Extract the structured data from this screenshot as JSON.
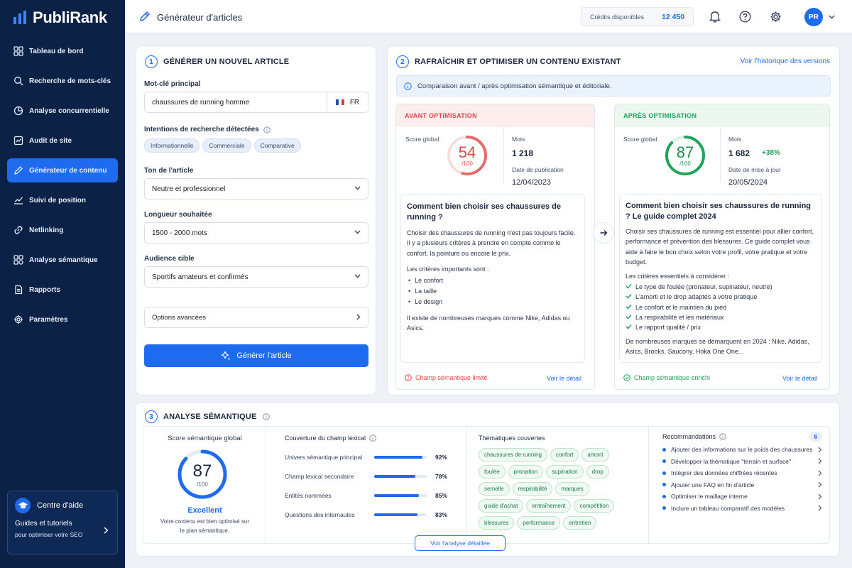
{
  "app": {
    "logo_text": "PubliRank"
  },
  "nav": [
    {
      "label": "Tableau de bord",
      "icon": "grid-icon"
    },
    {
      "label": "Recherche de mots-clés",
      "icon": "search-icon"
    },
    {
      "label": "Analyse concurrentielle",
      "icon": "competition-icon"
    },
    {
      "label": "Audit de site",
      "icon": "audit-icon"
    },
    {
      "label": "Générateur de contenu",
      "icon": "pen-icon",
      "active": true
    },
    {
      "label": "Suivi de position",
      "icon": "trend-icon"
    },
    {
      "label": "Netlinking",
      "icon": "link-icon"
    },
    {
      "label": "Analyse sémantique",
      "icon": "semantic-icon"
    },
    {
      "label": "Rapports",
      "icon": "report-icon"
    },
    {
      "label": "Paramètres",
      "icon": "gear-icon"
    }
  ],
  "help": {
    "title": "Centre d'aide",
    "line1": "Guides et tutoriels",
    "line2": "pour optimiser votre SEO"
  },
  "topbar": {
    "title": "Générateur d'articles",
    "credits_label": "Crédits disponibles",
    "credits_value": "12 450",
    "avatar": "PR"
  },
  "generate": {
    "num": "1",
    "title": "GÉNÉRER UN NOUVEL ARTICLE",
    "keyword_label": "Mot-clé principal",
    "keyword_value": "chaussures de running homme",
    "lang": "FR",
    "intent_label": "Intentions de recherche détectées",
    "intents": [
      "Informationnelle",
      "Commerciale",
      "Comparative"
    ],
    "tone_label": "Ton de l'article",
    "tone_value": "Neutre et professionnel",
    "length_label": "Longueur souhaitée",
    "length_value": "1500 - 2000 mots",
    "audience_label": "Audience cible",
    "audience_value": "Sportifs amateurs et confirmés",
    "advanced_label": "Options avancées",
    "button_label": "Générer l'article"
  },
  "optimize": {
    "num": "2",
    "title": "RAFRAÎCHIR ET OPTIMISER UN CONTENU EXISTANT",
    "history_link": "Voir l'historique des versions",
    "info": "Comparaison avant / après optimisation sémantique et éditoriale.",
    "before": {
      "header": "AVANT OPTIMISATION",
      "score_label": "Score global",
      "score": 54,
      "score_max": "/100",
      "words_label": "Mots",
      "words": "1 218",
      "date_label": "Date de publication",
      "date": "12/04/2023",
      "article_title": "Comment bien choisir ses chaussures de running ?",
      "para1": "Choisir des chaussures de running n'est pas toujours facile. Il y a plusieurs critères à prendre en compte comme le confort, la pointure ou encore le prix.",
      "criteria_title": "Les critères importants sont :",
      "criteria": [
        "Le confort",
        "La taille",
        "Le design"
      ],
      "para2": "Il existe de nombreuses marques comme Nike, Adidas ou Asics.",
      "status": "Champ sémantique limité",
      "detail": "Voir le détail"
    },
    "after": {
      "header": "APRÈS OPTIMISATION",
      "score_label": "Score global",
      "score": 87,
      "score_max": "/100",
      "words_label": "Mots",
      "words": "1 682",
      "delta": "+38%",
      "date_label": "Date de mise à jour",
      "date": "20/05/2024",
      "article_title": "Comment bien choisir ses chaussures de running ? Le guide complet 2024",
      "para1": "Choisir ses chaussures de running est essentiel pour allier confort, performance et prévention des blessures. Ce guide complet vous aide à faire le bon choix selon votre profil, votre pratique et votre budget.",
      "criteria_title": "Les critères essentiels à considérer :",
      "criteria": [
        "Le type de foulée (pronateur, supinateur, neutre)",
        "L'amorti et le drop adaptés à votre pratique",
        "Le confort et le maintien du pied",
        "La respirabilité et les matériaux",
        "Le rapport qualité / prix"
      ],
      "para2": "De nombreuses marques se démarquent en 2024 : Nike, Adidas, Asics, Brooks, Saucony, Hoka One One...",
      "status": "Champ sémantique enrichi",
      "detail": "Voir le détail"
    }
  },
  "semantic": {
    "num": "3",
    "title": "ANALYSE SÉMANTIQUE",
    "score_title": "Score sémantique global",
    "score": 87,
    "score_max": "/100",
    "grade": "Excellent",
    "grade_desc": "Votre contenu est bien optimisé sur le plan sémantique.",
    "coverage_title": "Couverture du champ lexical",
    "coverage": [
      {
        "label": "Univers sémantique principal",
        "value": 92,
        "text": "92%"
      },
      {
        "label": "Champ lexical secondaire",
        "value": 78,
        "text": "78%"
      },
      {
        "label": "Entités nommées",
        "value": 85,
        "text": "85%"
      },
      {
        "label": "Questions des internautes",
        "value": 83,
        "text": "83%"
      }
    ],
    "themes_title": "Thématiques couvertes",
    "themes": [
      "chaussures de running",
      "confort",
      "amorti",
      "foulée",
      "pronation",
      "supination",
      "drop",
      "semelle",
      "respirabilité",
      "marques",
      "guide d'achat",
      "entraînement",
      "compétition",
      "blessures",
      "performance",
      "entretien"
    ],
    "recs_title": "Recommandations",
    "recs_count": "6",
    "recs": [
      "Ajouter des informations sur le poids des chaussures",
      "Développer la thématique \"terrain et surface\"",
      "Intégrer des données chiffrées récentes",
      "Ajouter une FAQ en fin d'article",
      "Optimiser le maillage interne",
      "Inclure un tableau comparatif des modèles"
    ],
    "cta": "Voir l'analyse détaillée"
  },
  "colors": {
    "primary": "#1f6bf0",
    "sidebar": "#0b2146",
    "danger": "#e04848",
    "success": "#22a35a"
  }
}
